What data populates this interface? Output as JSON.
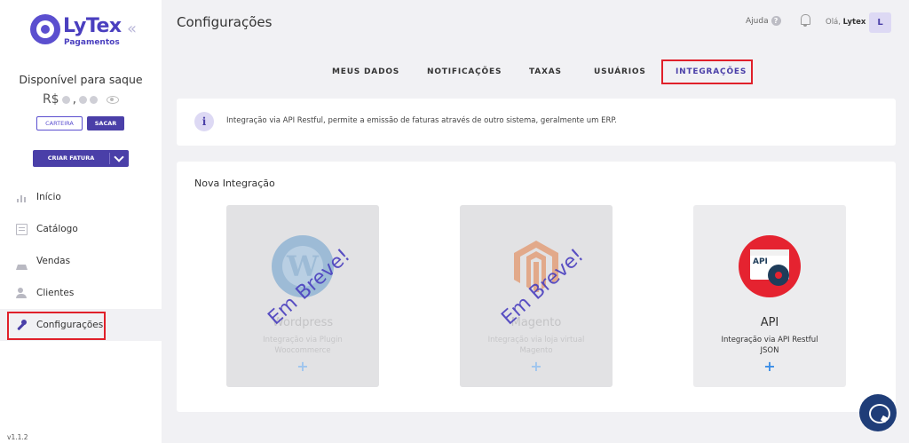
{
  "brand": {
    "name": "LyTex",
    "sub": "Pagamentos",
    "color": "#4a3fbf"
  },
  "sidebar": {
    "collapse_icon": "«",
    "saldo_title": "Disponível para saque",
    "saldo_prefix": "R$",
    "btn_carteira": "CARTEIRA",
    "btn_sacar": "SACAR",
    "btn_fatura": "CRIAR FATURA",
    "items": [
      {
        "label": "Início",
        "icon": "chart-icon"
      },
      {
        "label": "Catálogo",
        "icon": "catalog-icon"
      },
      {
        "label": "Vendas",
        "icon": "basket-icon"
      },
      {
        "label": "Clientes",
        "icon": "users-icon"
      },
      {
        "label": "Configurações",
        "icon": "wrench-icon",
        "active": true
      }
    ],
    "version": "v1.1.2"
  },
  "header": {
    "title": "Configurações",
    "help": "Ajuda",
    "help_icon": "?",
    "hello": "Olá,",
    "user": "Lytex",
    "avatar": "L"
  },
  "tabs": [
    {
      "label": "MEUS DADOS"
    },
    {
      "label": "NOTIFICAÇÕES"
    },
    {
      "label": "TAXAS"
    },
    {
      "label": "USUÁRIOS"
    },
    {
      "label": "INTEGRAÇÕES",
      "active": true
    }
  ],
  "info": {
    "icon": "i",
    "text": "Integração via API Restful, permite a emissão de faturas através de outro sistema, geralmente um ERP."
  },
  "integrations": {
    "title": "Nova Integração",
    "cards": [
      {
        "name": "Wordpress",
        "desc1": "Integração via Plugin",
        "desc2": "Woocommerce",
        "plus": "+",
        "soon": "Em Breve!",
        "logo_letter": "W"
      },
      {
        "name": "Magento",
        "desc1": "Integração via loja virtual",
        "desc2": "Magento",
        "plus": "+",
        "soon": "Em Breve!"
      },
      {
        "name": "API",
        "desc1": "Integração via API Restful",
        "desc2": "JSON",
        "plus": "+",
        "logo_label": "API"
      }
    ]
  },
  "colors": {
    "accent": "#4a3fa8",
    "highlight": "#e0202a",
    "plus": "#3c8ee6"
  }
}
